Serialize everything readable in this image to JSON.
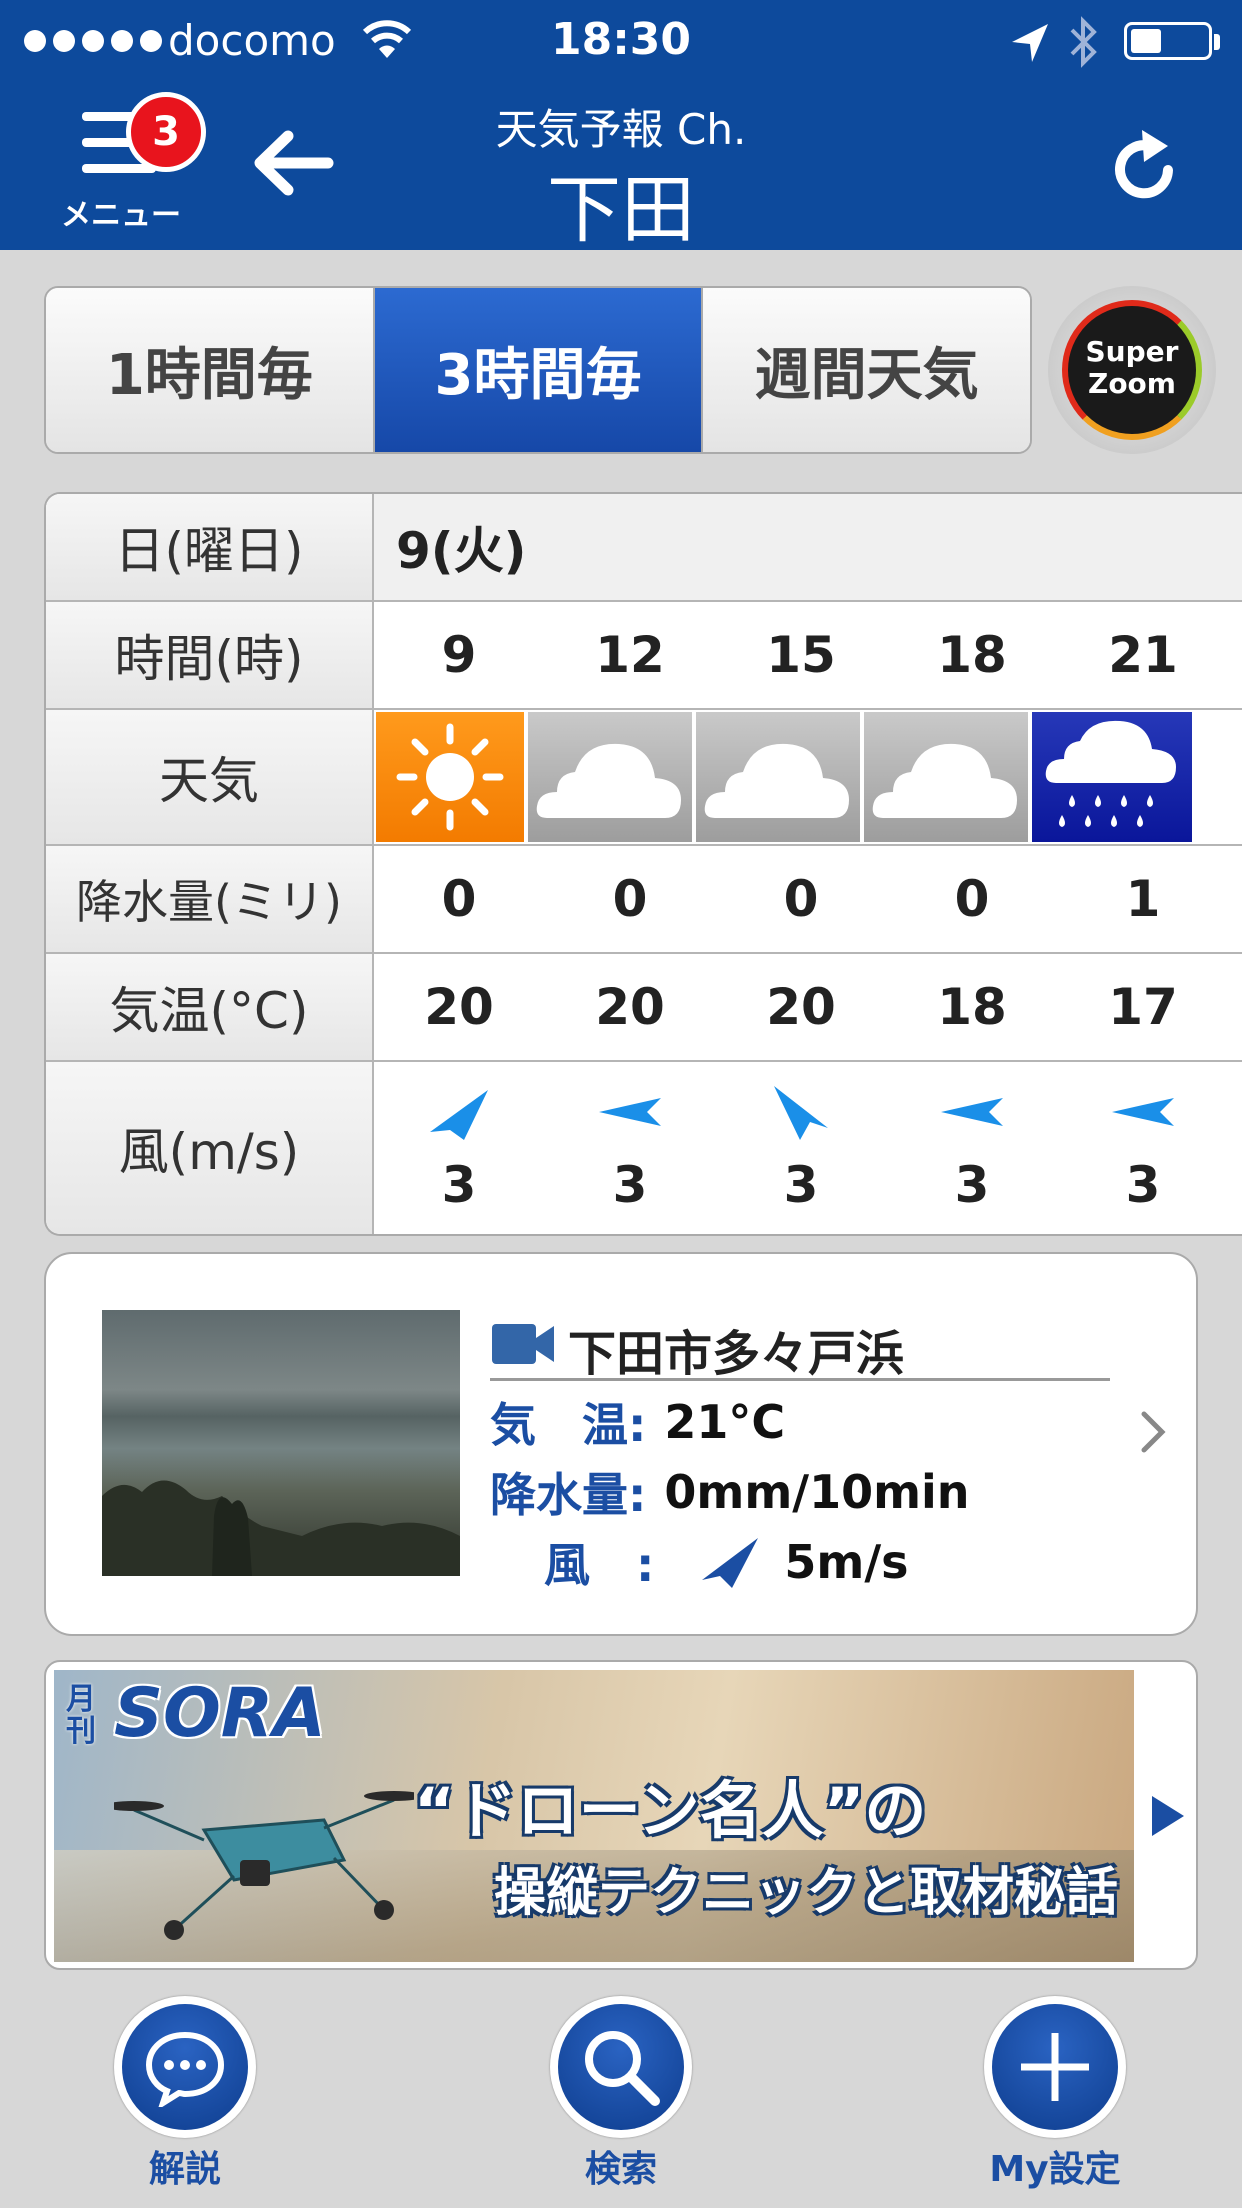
{
  "status_bar": {
    "carrier": "docomo",
    "time": "18:30"
  },
  "header": {
    "menu_label": "メニュー",
    "menu_badge": "3",
    "app_title": "天気予報 Ch.",
    "city": "下田"
  },
  "tabs": [
    {
      "label": "1時間毎",
      "active": false
    },
    {
      "label": "3時間毎",
      "active": true
    },
    {
      "label": "週間天気",
      "active": false
    }
  ],
  "superzoom": {
    "line1": "Super",
    "line2": "Zoom"
  },
  "forecast": {
    "labels": {
      "date": "日(曜日)",
      "hour": "時間(時)",
      "weather": "天気",
      "precip": "降水量(ミリ)",
      "temp": "気温(°C)",
      "wind": "風(m/s)"
    },
    "date_value": "9(火)",
    "hours": [
      "9",
      "12",
      "15",
      "18",
      "21"
    ],
    "weather": [
      "sunny-icon",
      "cloudy-icon",
      "cloudy-icon",
      "cloudy-icon",
      "rain-icon"
    ],
    "precip": [
      "0",
      "0",
      "0",
      "0",
      "1"
    ],
    "temp": [
      "20",
      "20",
      "20",
      "18",
      "17"
    ],
    "wind_speed": [
      "3",
      "3",
      "3",
      "3",
      "3"
    ],
    "wind_direction_icon": [
      "arrow-ene-icon",
      "arrow-west-icon",
      "arrow-nw-icon",
      "arrow-west-icon",
      "arrow-west-icon"
    ]
  },
  "live_camera": {
    "title": "下田市多々戸浜",
    "temp_label": "気　温:",
    "temp_value": "21°C",
    "precip_label": "降水量:",
    "precip_value": "0mm/10min",
    "wind_label": "風　:",
    "wind_value": "5m/s"
  },
  "ad": {
    "mag_small": "月刊",
    "mag": "SORA",
    "line1": "“ドローン名人”の",
    "line2": "操縦テクニックと取材秘話"
  },
  "bottom_nav": [
    {
      "label": "解説",
      "icon": "chat-bubble-icon"
    },
    {
      "label": "検索",
      "icon": "search-icon"
    },
    {
      "label": "My設定",
      "icon": "plus-icon"
    }
  ],
  "colors": {
    "brand_blue": "#0d4a9c",
    "sunny": "#f37b00",
    "rain": "#0a169a",
    "badge": "#e8141d"
  }
}
